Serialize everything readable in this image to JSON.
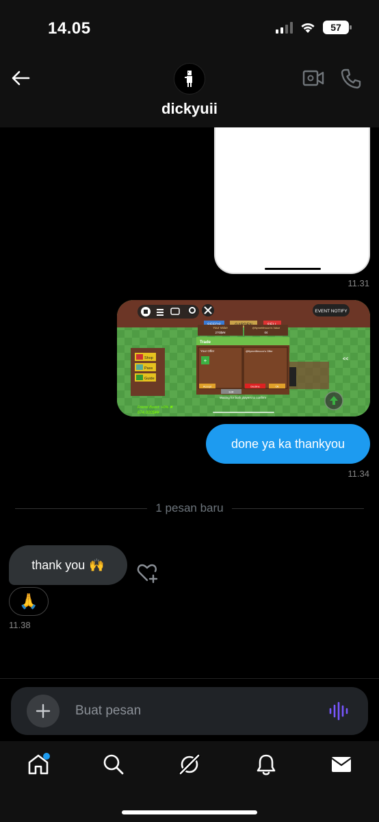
{
  "status_bar": {
    "time": "14.05",
    "battery": "57"
  },
  "header": {
    "contact_name": "dickyuii"
  },
  "messages": [
    {
      "type": "image",
      "direction": "outgoing",
      "description_icon": "screenshot-image",
      "timestamp": "11.31"
    },
    {
      "type": "image",
      "direction": "outgoing",
      "description_icon": "game-screenshot-image",
      "game_text": {
        "event_button": "EVENT NOTIFY",
        "tab_seeds": "SEEDS",
        "tab_garden": "GARDEN",
        "tab_sell": "SELL",
        "your_value_label": "Your Value",
        "your_value": "270$¥¥",
        "other_value_label": "@flymettfmoon's Value",
        "other_value": "0¢",
        "trade_title": "Trade",
        "your_offer": "Your Offer",
        "other_offer": "@flymettfmoon's Offer",
        "accept": "Accept",
        "decline": "Decline",
        "edit": "Edit",
        "ready": "Ok",
        "waiting": "Waiting for both players to confirm",
        "menu_shop": "Shop",
        "menu_pass": "Pass",
        "menu_guide": "Guide",
        "friend_boost": "Friend Boost: +0% ✖",
        "money": "674,000$¥¥",
        "arrows": "<<"
      }
    },
    {
      "type": "text",
      "direction": "outgoing",
      "text": "done ya ka thankyou",
      "timestamp": "11.34"
    },
    {
      "type": "text",
      "direction": "incoming",
      "text": "thank you",
      "emoji": "🙌",
      "reaction": "🙏",
      "timestamp": "11.38"
    }
  ],
  "divider": {
    "label": "1 pesan baru"
  },
  "composer": {
    "placeholder": "Buat pesan"
  },
  "nav": {
    "items": [
      {
        "icon": "home-icon",
        "badge": true
      },
      {
        "icon": "search-icon"
      },
      {
        "icon": "grok-icon"
      },
      {
        "icon": "bell-icon"
      },
      {
        "icon": "mail-icon"
      }
    ]
  },
  "colors": {
    "accent": "#1d9bf0",
    "incoming_bubble": "#2f3336",
    "voice_icon": "#7856ff"
  }
}
